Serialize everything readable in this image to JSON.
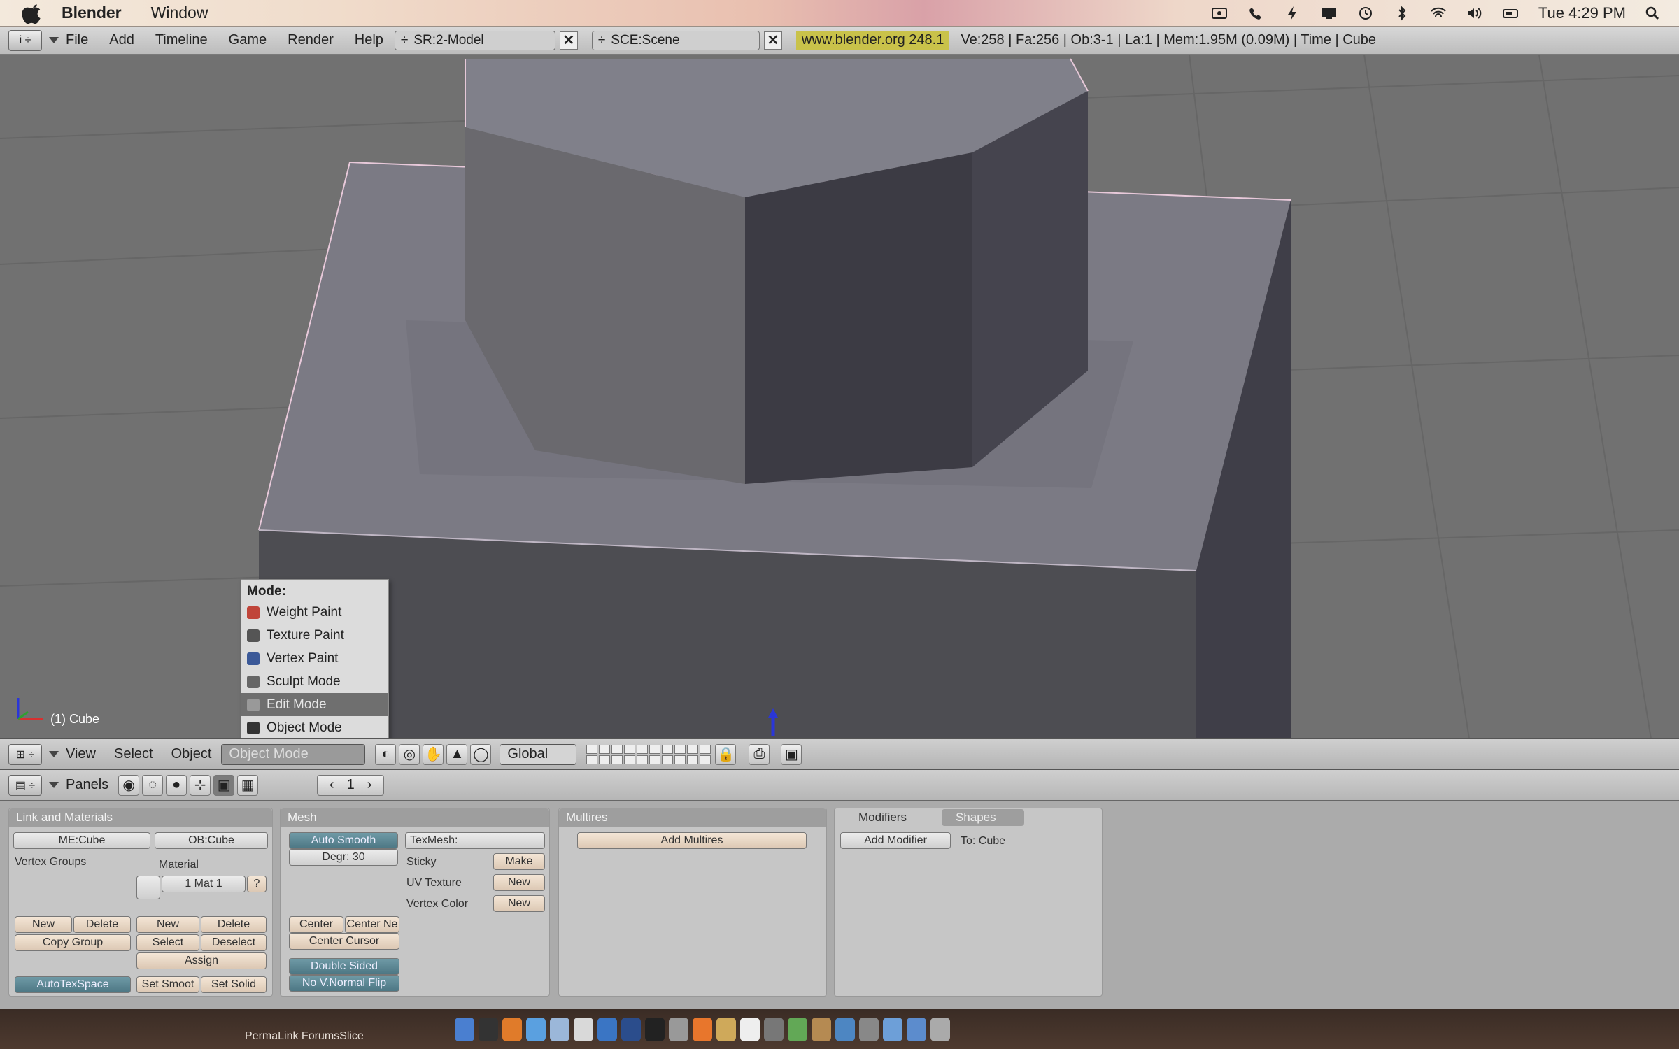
{
  "mac_menubar": {
    "app_name": "Blender",
    "menus": [
      "Window"
    ],
    "clock": "Tue 4:29 PM"
  },
  "info_header": {
    "menus": [
      "File",
      "Add",
      "Timeline",
      "Game",
      "Render",
      "Help"
    ],
    "screen": "SR:2-Model",
    "scene": "SCE:Scene",
    "website": "www.blender.org 248.1",
    "stats": "Ve:258 | Fa:256 | Ob:3-1 | La:1 | Mem:1.95M (0.09M) | Time | Cube"
  },
  "viewport": {
    "object_label": "(1) Cube"
  },
  "mode_menu": {
    "title": "Mode:",
    "items": [
      {
        "label": "Weight Paint",
        "icon": "weight-paint-icon",
        "color": "#c0453a"
      },
      {
        "label": "Texture Paint",
        "icon": "texture-paint-icon",
        "color": "#555555"
      },
      {
        "label": "Vertex Paint",
        "icon": "vertex-paint-icon",
        "color": "#3b5998"
      },
      {
        "label": "Sculpt Mode",
        "icon": "sculpt-icon",
        "color": "#666666"
      },
      {
        "label": "Edit Mode",
        "icon": "edit-mode-icon",
        "color": "#888888"
      },
      {
        "label": "Object Mode",
        "icon": "object-mode-icon",
        "color": "#333333"
      }
    ],
    "selected": "Edit Mode"
  },
  "view_header": {
    "menus": [
      "View",
      "Select",
      "Object"
    ],
    "mode_value": "Object Mode",
    "orientation": "Global"
  },
  "buttons_header": {
    "panels_label": "Panels",
    "frame": "1"
  },
  "link_materials_panel": {
    "title": "Link and Materials",
    "mesh_field": "ME:Cube",
    "object_field": "OB:Cube",
    "vertex_groups": "Vertex Groups",
    "material": "Material",
    "mat_index": "1 Mat 1",
    "new": "New",
    "delete": "Delete",
    "copy_group": "Copy Group",
    "select": "Select",
    "deselect": "Deselect",
    "assign": "Assign",
    "autotex": "AutoTexSpace",
    "set_smooth": "Set Smoot",
    "set_solid": "Set Solid"
  },
  "mesh_panel": {
    "title": "Mesh",
    "auto_smooth": "Auto Smooth",
    "degr": "Degr: 30",
    "texmesh": "TexMesh:",
    "sticky": "Sticky",
    "make": "Make",
    "uv_texture": "UV Texture",
    "vertex_color": "Vertex Color",
    "new": "New",
    "center": "Center",
    "center_new": "Center Ne",
    "center_cursor": "Center Cursor",
    "double_sided": "Double Sided",
    "no_v_normal": "No V.Normal Flip"
  },
  "multires_panel": {
    "title": "Multires",
    "add_multires": "Add Multires"
  },
  "modifiers_panel": {
    "tab_modifiers": "Modifiers",
    "tab_shapes": "Shapes",
    "add_modifier": "Add Modifier",
    "to_label": "To: Cube"
  },
  "dock": {
    "caption": "PermaLink ForumsSlice"
  }
}
